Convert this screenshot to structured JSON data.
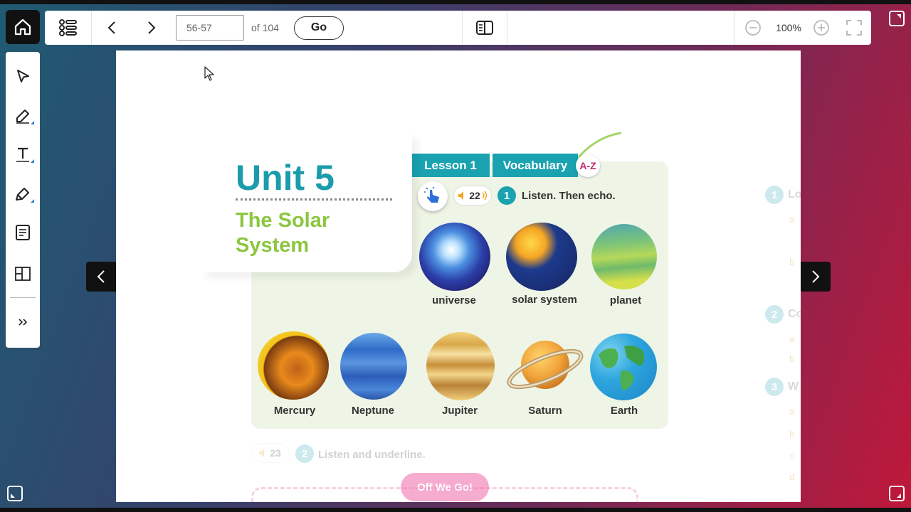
{
  "toolbar": {
    "page_value": "56-57",
    "of_label": "of 104",
    "go_label": "Go",
    "zoom_label": "100%"
  },
  "lesson": {
    "unit_title": "Unit 5",
    "unit_subtitle_line1": "The Solar",
    "unit_subtitle_line2": "System",
    "lesson_tab": "Lesson 1",
    "vocab_tab": "Vocabulary",
    "az_badge": "A-Z",
    "audio_track_1": "22",
    "exercise_1_number": "1",
    "exercise_1_instruction": "Listen. Then echo.",
    "audio_track_2": "23",
    "exercise_2_number": "2",
    "exercise_2_instruction": "Listen and underline.",
    "off_we_go": "Off We Go!"
  },
  "vocabulary": [
    "universe",
    "solar system",
    "planet",
    "Mercury",
    "Neptune",
    "Jupiter",
    "Saturn",
    "Earth"
  ],
  "right_page_fragments": {
    "ex1_number": "1",
    "ex1_text": "Lo",
    "ex2_number": "2",
    "ex2_text": "Co",
    "ex3_number": "3",
    "ex3_text": "W",
    "letter_a": "a",
    "letter_b": "b",
    "letter_c": "c",
    "letter_d": "d"
  },
  "colors": {
    "accent_teal": "#1aa2b0",
    "accent_green": "#8cc63f",
    "panel_bg": "#eef5e6"
  },
  "icons": {
    "home": "home-icon",
    "toc": "list-icon",
    "prev": "chevron-left-icon",
    "next": "chevron-right-icon",
    "reading_mode": "book-open-icon",
    "zoom_out": "zoom-out-icon",
    "zoom_in": "zoom-in-icon",
    "fullscreen": "fullscreen-icon",
    "select": "pointer-icon",
    "pen": "pen-icon",
    "text": "text-icon",
    "highlighter": "highlighter-icon",
    "notes": "notes-icon",
    "layout": "layout-icon",
    "expand": "double-chevron-icon"
  }
}
